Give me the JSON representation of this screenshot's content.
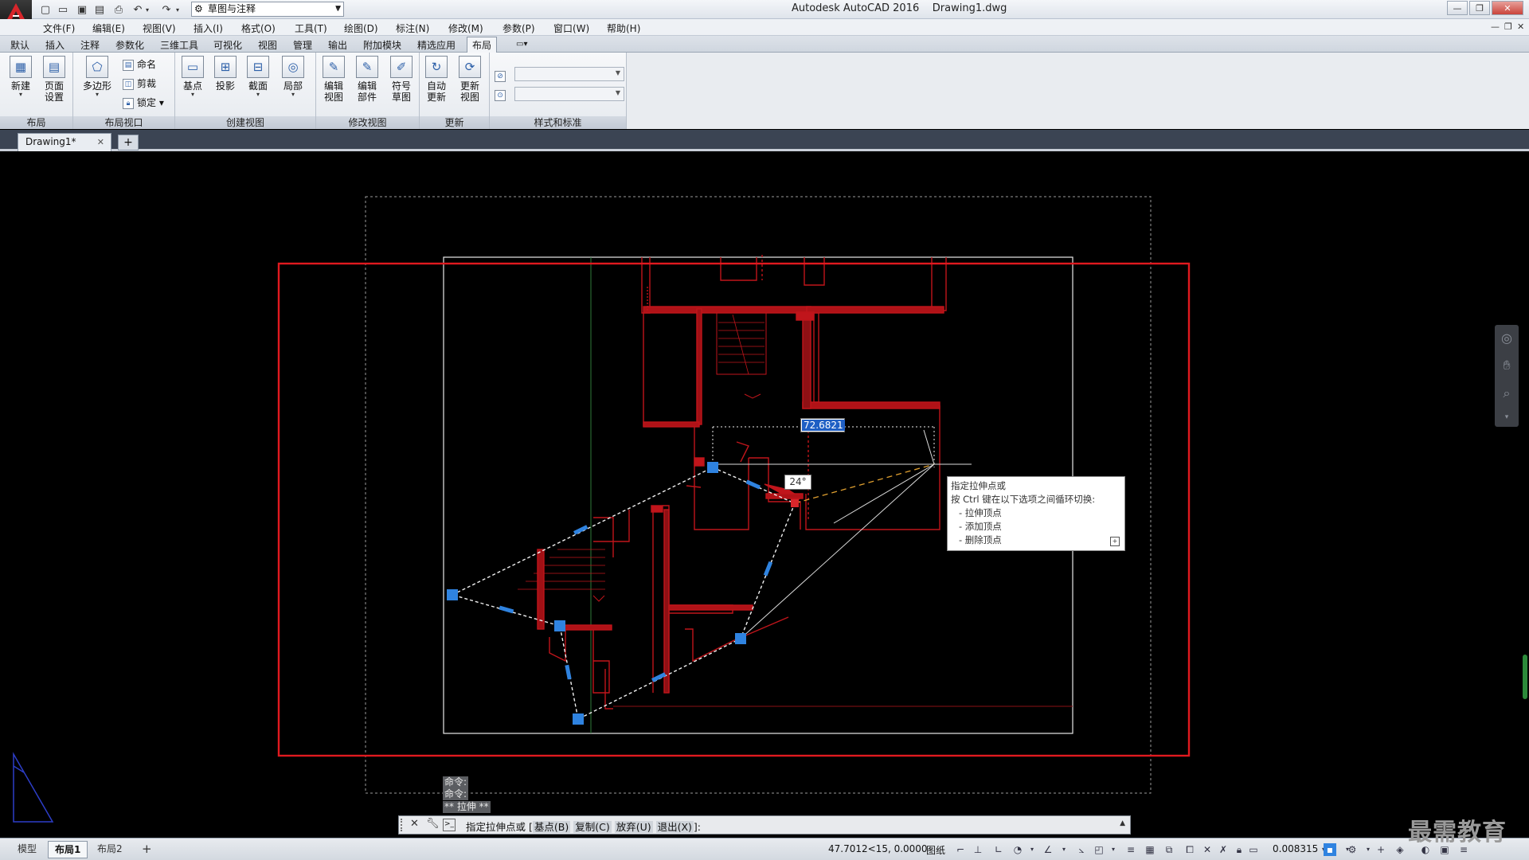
{
  "title": {
    "app_name": "Autodesk AutoCAD 2016",
    "file_name": "Drawing1.dwg",
    "workspace": "草图与注释"
  },
  "menu": [
    "文件(F)",
    "编辑(E)",
    "视图(V)",
    "插入(I)",
    "格式(O)",
    "工具(T)",
    "绘图(D)",
    "标注(N)",
    "修改(M)",
    "参数(P)",
    "窗口(W)",
    "帮助(H)"
  ],
  "ribbon_tabs": [
    "默认",
    "插入",
    "注释",
    "参数化",
    "三维工具",
    "可视化",
    "视图",
    "管理",
    "输出",
    "附加模块",
    "精选应用",
    "布局"
  ],
  "ribbon": {
    "layout_panel": {
      "title": "布局",
      "new": "新建",
      "page_setup_1": "页面",
      "page_setup_2": "设置"
    },
    "viewport_panel": {
      "title": "布局视口",
      "polygon": "多边形",
      "named": "命名",
      "clip": "剪裁",
      "lock": "锁定"
    },
    "create_view_panel": {
      "title": "创建视图",
      "base": "基点",
      "projected": "投影",
      "section": "截面",
      "detail": "局部"
    },
    "modify_view_panel": {
      "title": "修改视图",
      "edit_view_1": "编辑",
      "edit_view_2": "视图",
      "edit_comp_1": "编辑",
      "edit_comp_2": "部件",
      "symbol_1": "符号",
      "symbol_2": "草图"
    },
    "update_panel": {
      "title": "更新",
      "auto_1": "自动",
      "auto_2": "更新",
      "update_1": "更新",
      "update_2": "视图"
    },
    "styles_panel": {
      "title": "样式和标准"
    }
  },
  "doc_tab": {
    "name": "Drawing1*"
  },
  "overlay": {
    "dim_value": "72.6821",
    "angle": "24°",
    "tooltip_title": "指定拉伸点或",
    "tooltip_hint": "按 Ctrl 键在以下选项之间循环切换:",
    "tooltip_options": [
      "- 拉伸顶点",
      "- 添加顶点",
      "- 删除顶点"
    ]
  },
  "command": {
    "history": [
      "命令:",
      "命令:",
      "** 拉伸 **"
    ],
    "prompt": "指定拉伸点或",
    "opt_base": "基点(B)",
    "opt_copy": "复制(C)",
    "opt_undo": "放弃(U)",
    "opt_exit": "退出(X)",
    "bracket_open": "[",
    "bracket_close": "]:"
  },
  "status": {
    "tabs": [
      "模型",
      "布局1",
      "布局2"
    ],
    "coords": "47.7012<15, 0.0000",
    "space": "图纸",
    "scale": "0.008315"
  },
  "watermark": "最需教育",
  "colors": {
    "wall": "#c0151b",
    "grip": "#2f83e0",
    "highlight_box": "#e0191f",
    "sheet_border": "#ffffff"
  }
}
